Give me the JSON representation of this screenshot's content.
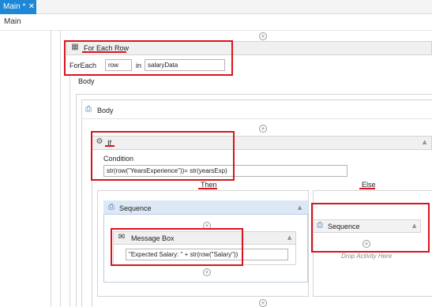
{
  "tab": {
    "title": "Main *",
    "close_glyph": "✕"
  },
  "breadcrumb": "Main",
  "glyphs": {
    "plus": "+",
    "collapse": "⩓"
  },
  "for_each": {
    "title": "For Each Row",
    "foreach_label": "ForEach",
    "row_value": "row",
    "in_label": "in",
    "data_value": "salaryData",
    "body_label": "Body"
  },
  "body_sequence": {
    "title": "Body"
  },
  "if_activity": {
    "title": "If",
    "condition_label": "Condition",
    "condition_value": "str(row(\"YearsExperience\"))= str(yearsExp)",
    "then_label": "Then",
    "else_label": "Else"
  },
  "then_sequence": {
    "title": "Sequence"
  },
  "message_box": {
    "title": "Message Box",
    "text_value": "\"Expected Salary: \" + str(row(\"Salary\"))"
  },
  "else_sequence": {
    "title": "Sequence",
    "drop_text": "Drop Activity Here"
  },
  "colors": {
    "tab": "#1e87d6",
    "highlight": "#d9141e",
    "sequence_header": "#dce8f5"
  }
}
